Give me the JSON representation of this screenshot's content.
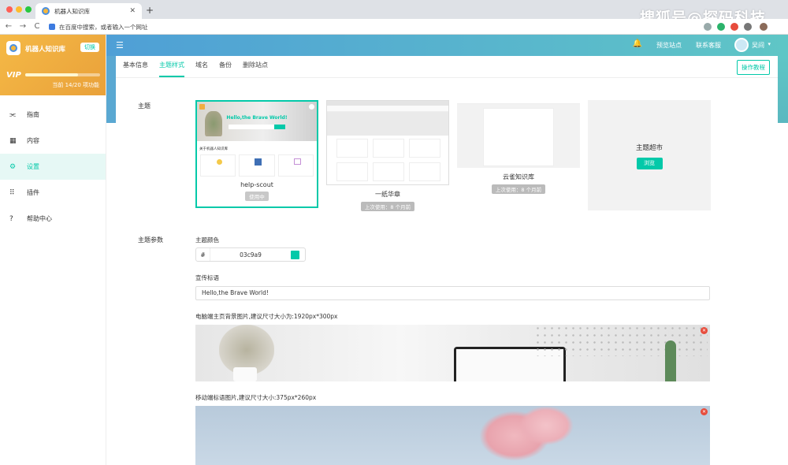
{
  "browser": {
    "tab_title": "机器人知识库",
    "tab_close": "✕",
    "new_tab": "+",
    "address_placeholder": "在百度中搜索，或者输入一个网址",
    "nav_back": "←",
    "nav_forward": "→",
    "nav_reload": "C",
    "watermark": "搜狐号@探码科技"
  },
  "sidebar": {
    "site_name": "机器人知识库",
    "switch_label": "切换",
    "vip_label": "VIP",
    "quota_text": "当前 14/20 项功能",
    "quota_progress": 0.7,
    "items": [
      {
        "label": "指南",
        "icon": "sliders-icon"
      },
      {
        "label": "内容",
        "icon": "grid-icon"
      },
      {
        "label": "设置",
        "icon": "gear-icon"
      },
      {
        "label": "插件",
        "icon": "apps-icon"
      },
      {
        "label": "帮助中心",
        "icon": "help-icon"
      }
    ],
    "active_index": 2
  },
  "header": {
    "preview_site": "预览站点",
    "contact_support": "联系客服",
    "user_name": "吴间",
    "caret": "▾",
    "hamburger": "☰",
    "bell": "🔔"
  },
  "tabs": {
    "items": [
      "基本信息",
      "主题样式",
      "域名",
      "备份",
      "删除站点"
    ],
    "active_index": 1,
    "help_button": "操作教程"
  },
  "theme_section": {
    "label": "主题",
    "themes": [
      {
        "name": "help-scout",
        "badge": "使用中",
        "hero_text": "Hello,the Brave World!",
        "section_text": "关于机器人知识库"
      },
      {
        "name": "一纸华章",
        "badge": "上次使用：8 个月前"
      },
      {
        "name": "云雀知识库",
        "badge": "上次使用：8 个月前"
      }
    ],
    "market_title": "主题超市",
    "market_button": "浏览"
  },
  "params": {
    "label": "主题参数",
    "color_label": "主题颜色",
    "color_hash": "#",
    "color_value": "03c9a9",
    "slogan_label": "宣传标语",
    "slogan_value": "Hello,the Brave World!",
    "desktop_bg_label": "电脑端主页背景图片,建议尺寸大小为:1920px*300px",
    "mobile_bg_label": "移动端标语图片,建议尺寸大小:375px*260px",
    "delete_icon": "✕"
  },
  "colors": {
    "accent": "#03c9a9",
    "header_start": "#4f9fd6",
    "header_end": "#5fc6c6",
    "brand": "#f0ad40"
  }
}
